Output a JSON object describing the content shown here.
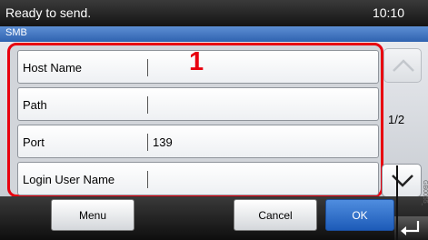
{
  "status": {
    "message": "Ready to send.",
    "clock": "10:10"
  },
  "title": "SMB",
  "callout": "1",
  "fields": [
    {
      "label": "Host Name",
      "value": ""
    },
    {
      "label": "Path",
      "value": ""
    },
    {
      "label": "Port",
      "value": "139"
    },
    {
      "label": "Login User Name",
      "value": ""
    }
  ],
  "pagination": {
    "indicator": "1/2"
  },
  "buttons": {
    "menu": "Menu",
    "cancel": "Cancel",
    "ok": "OK"
  },
  "watermark": "GB0055_08",
  "colors": {
    "callout_red": "#e8000f",
    "ok_blue": "#1d5bb8",
    "title_blue": "#2f62b0"
  },
  "icons": {
    "scroll_up": "chevron-up-icon",
    "scroll_down": "chevron-down-icon",
    "enter": "enter-arrow-icon"
  }
}
